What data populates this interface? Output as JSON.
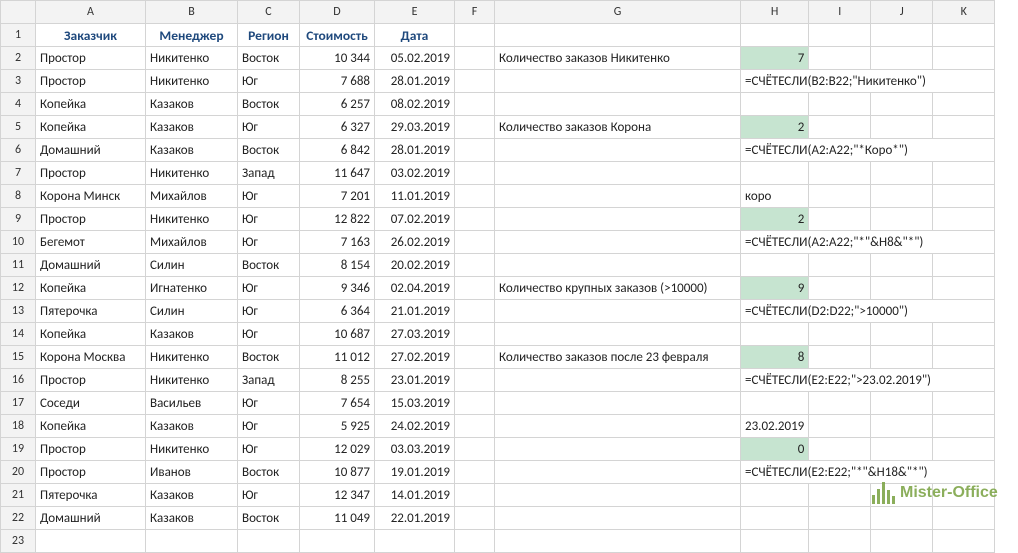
{
  "columns": [
    "A",
    "B",
    "C",
    "D",
    "E",
    "F",
    "G",
    "H",
    "I",
    "J",
    "K"
  ],
  "headers": {
    "A": "Заказчик",
    "B": "Менеджер",
    "C": "Регион",
    "D": "Стоимость",
    "E": "Дата"
  },
  "rows": [
    {
      "n": 2,
      "A": "Простор",
      "B": "Никитенко",
      "C": "Восток",
      "D": "10 344",
      "E": "05.02.2019",
      "G": "Количество заказов Никитенко",
      "H": "7",
      "Hclass": "green"
    },
    {
      "n": 3,
      "A": "Простор",
      "B": "Никитенко",
      "C": "Юг",
      "D": "7 688",
      "E": "28.01.2019",
      "H": "=СЧЁТЕСЛИ(B2:B22;\"Никитенко\")"
    },
    {
      "n": 4,
      "A": "Копейка",
      "B": "Казаков",
      "C": "Восток",
      "D": "6 257",
      "E": "08.02.2019"
    },
    {
      "n": 5,
      "A": "Копейка",
      "B": "Казаков",
      "C": "Юг",
      "D": "6 327",
      "E": "29.03.2019",
      "G": "Количество заказов Корона",
      "H": "2",
      "Hclass": "green"
    },
    {
      "n": 6,
      "A": "Домашний",
      "B": "Казаков",
      "C": "Восток",
      "D": "6 842",
      "E": "28.01.2019",
      "H": "=СЧЁТЕСЛИ(A2:A22;\"*Коро*\")"
    },
    {
      "n": 7,
      "A": "Простор",
      "B": "Никитенко",
      "C": "Запад",
      "D": "11 647",
      "E": "03.02.2019"
    },
    {
      "n": 8,
      "A": "Корона Минск",
      "B": "Михайлов",
      "C": "Юг",
      "D": "7 201",
      "E": "11.01.2019",
      "H": "коро"
    },
    {
      "n": 9,
      "A": "Простор",
      "B": "Никитенко",
      "C": "Юг",
      "D": "12 822",
      "E": "07.02.2019",
      "H": "2",
      "Hclass": "green"
    },
    {
      "n": 10,
      "A": "Бегемот",
      "B": "Михайлов",
      "C": "Юг",
      "D": "7 163",
      "E": "26.02.2019",
      "H": "=СЧЁТЕСЛИ(A2:A22;\"*\"&H8&\"*\")"
    },
    {
      "n": 11,
      "A": "Домашний",
      "B": "Силин",
      "C": "Восток",
      "D": "8 154",
      "E": "20.02.2019"
    },
    {
      "n": 12,
      "A": "Копейка",
      "B": "Игнатенко",
      "C": "Юг",
      "D": "9 346",
      "E": "02.04.2019",
      "G": "Количество крупных заказов (>10000)",
      "H": "9",
      "Hclass": "green"
    },
    {
      "n": 13,
      "A": "Пятерочка",
      "B": "Силин",
      "C": "Юг",
      "D": "6 364",
      "E": "21.01.2019",
      "H": "=СЧЁТЕСЛИ(D2:D22;\">10000\")"
    },
    {
      "n": 14,
      "A": "Копейка",
      "B": "Казаков",
      "C": "Юг",
      "D": "10 687",
      "E": "27.03.2019"
    },
    {
      "n": 15,
      "A": "Корона Москва",
      "B": "Никитенко",
      "C": "Восток",
      "D": "11 012",
      "E": "27.02.2019",
      "G": "Количество заказов после 23 февраля",
      "H": "8",
      "Hclass": "green"
    },
    {
      "n": 16,
      "A": "Простор",
      "B": "Никитенко",
      "C": "Запад",
      "D": "8 255",
      "E": "23.01.2019",
      "H": "=СЧЁТЕСЛИ(E2:E22;\">23.02.2019\")"
    },
    {
      "n": 17,
      "A": "Соседи",
      "B": "Васильев",
      "C": "Юг",
      "D": "7 654",
      "E": "15.03.2019"
    },
    {
      "n": 18,
      "A": "Копейка",
      "B": "Казаков",
      "C": "Юг",
      "D": "5 925",
      "E": "24.02.2019",
      "H": "23.02.2019",
      "Halign": "right"
    },
    {
      "n": 19,
      "A": "Простор",
      "B": "Никитенко",
      "C": "Юг",
      "D": "12 029",
      "E": "03.03.2019",
      "H": "0",
      "Hclass": "green"
    },
    {
      "n": 20,
      "A": "Простор",
      "B": "Иванов",
      "C": "Восток",
      "D": "10 877",
      "E": "19.01.2019",
      "H": "=СЧЁТЕСЛИ(E2:E22;\"*\"&H18&\"*\")"
    },
    {
      "n": 21,
      "A": "Пятерочка",
      "B": "Казаков",
      "C": "Юг",
      "D": "12 347",
      "E": "14.01.2019"
    },
    {
      "n": 22,
      "A": "Домашний",
      "B": "Казаков",
      "C": "Восток",
      "D": "11 049",
      "E": "22.01.2019"
    },
    {
      "n": 23
    }
  ],
  "colwidths": {
    "rowhdr": 27,
    "A": 110,
    "B": 92,
    "C": 62,
    "D": 75,
    "E": 80,
    "F": 40,
    "G": 246,
    "H": 62,
    "I": 62,
    "J": 62,
    "K": 62
  },
  "logo": "Mister-Office"
}
